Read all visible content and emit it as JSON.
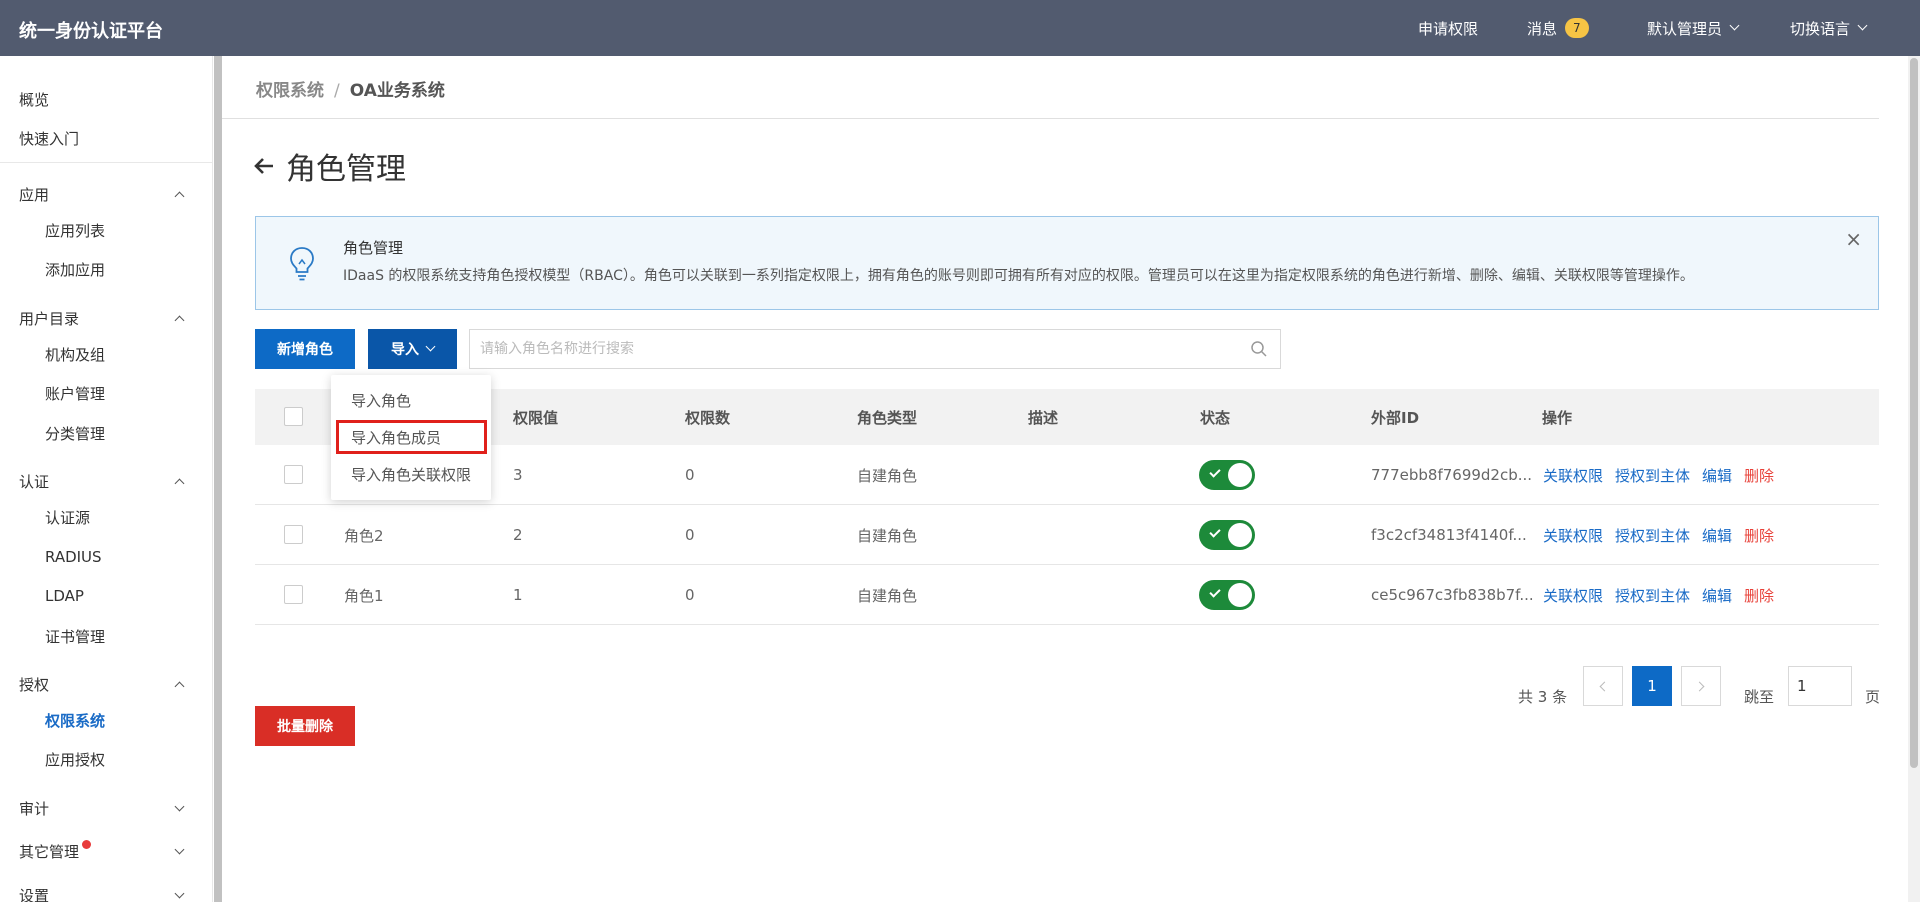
{
  "topbar": {
    "brand": "统一身份认证平台",
    "apply_permission": "申请权限",
    "messages": "消息",
    "message_count": "7",
    "user": "默认管理员",
    "language": "切换语言"
  },
  "sidebar": {
    "overview": "概览",
    "quickstart": "快速入门",
    "apps": {
      "label": "应用",
      "items": [
        "应用列表",
        "添加应用"
      ]
    },
    "directory": {
      "label": "用户目录",
      "items": [
        "机构及组",
        "账户管理",
        "分类管理"
      ]
    },
    "auth": {
      "label": "认证",
      "items": [
        "认证源",
        "RADIUS",
        "LDAP",
        "证书管理"
      ]
    },
    "authorize": {
      "label": "授权",
      "items": [
        "权限系统",
        "应用授权"
      ]
    },
    "audit": "审计",
    "other": "其它管理",
    "settings": "设置"
  },
  "breadcrumb": {
    "root": "权限系统",
    "sep": "/",
    "current": "OA业务系统"
  },
  "page": {
    "title": "角色管理"
  },
  "alert": {
    "title": "角色管理",
    "text": "IDaaS 的权限系统支持角色授权模型（RBAC）。角色可以关联到一系列指定权限上，拥有角色的账号则即可拥有所有对应的权限。管理员可以在这里为指定权限系统的角色进行新增、删除、编辑、关联权限等管理操作。",
    "close": "×"
  },
  "toolbar": {
    "add_role": "新增角色",
    "import": "导入",
    "search_placeholder": "请输入角色名称进行搜索"
  },
  "dropdown": [
    "导入角色",
    "导入角色成员",
    "导入角色关联权限"
  ],
  "table": {
    "headers": [
      "权限值",
      "权限数",
      "角色类型",
      "描述",
      "状态",
      "外部ID",
      "操作"
    ],
    "rows": [
      {
        "name": "",
        "value": "3",
        "count": "0",
        "type": "自建角色",
        "desc": "",
        "ext_id": "777ebb8f7699d2cb...",
        "enabled": true
      },
      {
        "name": "角色2",
        "value": "2",
        "count": "0",
        "type": "自建角色",
        "desc": "",
        "ext_id": "f3c2cf34813f4140f...",
        "enabled": true
      },
      {
        "name": "角色1",
        "value": "1",
        "count": "0",
        "type": "自建角色",
        "desc": "",
        "ext_id": "ce5c967c3fb838b7f...",
        "enabled": true
      }
    ],
    "actions": [
      "关联权限",
      "授权到主体",
      "编辑",
      "删除"
    ]
  },
  "pagination": {
    "total": "共 3 条",
    "current": "1",
    "goto": "跳至",
    "goto_value": "1",
    "page_suffix": "页"
  },
  "batch_delete": "批量删除",
  "colors": {
    "topbar": "#525b6f",
    "primary": "#0d6ac6",
    "danger": "#d92e26",
    "toggle_on": "#1d8a3a",
    "badge": "#f6c445"
  }
}
